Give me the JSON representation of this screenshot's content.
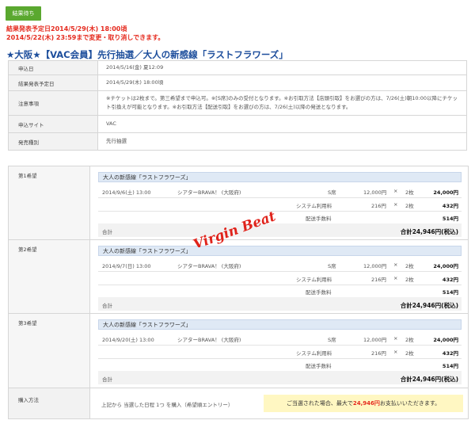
{
  "status_badge": "結果待ち",
  "notice": {
    "line1": "結果発表予定日2014/5/29(木) 18:00頃",
    "line2": "2014/5/22(木) 23:59まで変更・取り消しできます。"
  },
  "title": "★大阪★【VAC会員】先行抽選／大人の新感線「ラストフラワーズ」",
  "info": [
    {
      "label": "申込日",
      "value": "2014/5/16(金) 夏12:09"
    },
    {
      "label": "結果発表予定日",
      "value": "2014/5/29(木) 18:00頃"
    },
    {
      "label": "注意事項",
      "value": "※チケットは2枚まで。第三希望まで申込可。※[S席]のみの受付となります。※お引取方法【店頭引取】をお選びの方は、7/26(土)朝10:00以降にチケット引換えが可能となります。※お引取方法【配送引取】をお選びの方は、7/26(土)以降の発送となります。"
    },
    {
      "label": "申込サイト",
      "value": "VAC"
    },
    {
      "label": "発売種別",
      "value": "先行抽選"
    }
  ],
  "hopes": [
    {
      "label": "第1希望",
      "event": "大人の新感線「ラストフラワーズ」",
      "date": "2014/9/6(土) 13:00",
      "venue": "シアターBRAVA！ (大阪府)",
      "seat": "S席",
      "unit_price": "12,000円",
      "times": "×",
      "qty": "2枚",
      "amount": "24,000円",
      "sys_label": "システム利用料",
      "sys_unit": "216円",
      "sys_qty": "2枚",
      "sys_amount": "432円",
      "ship_label": "配送手数料",
      "ship_amount": "514円",
      "total_label": "合計",
      "total": "合計24,946円(税込)"
    },
    {
      "label": "第2希望",
      "event": "大人の新感線「ラストフラワーズ」",
      "date": "2014/9/7(日) 13:00",
      "venue": "シアターBRAVA！ (大阪府)",
      "seat": "S席",
      "unit_price": "12,000円",
      "times": "×",
      "qty": "2枚",
      "amount": "24,000円",
      "sys_label": "システム利用料",
      "sys_unit": "216円",
      "sys_qty": "2枚",
      "sys_amount": "432円",
      "ship_label": "配送手数料",
      "ship_amount": "514円",
      "total_label": "合計",
      "total": "合計24,946円(税込)"
    },
    {
      "label": "第3希望",
      "event": "大人の新感線「ラストフラワーズ」",
      "date": "2014/9/20(土) 13:00",
      "venue": "シアターBRAVA！ (大阪府)",
      "seat": "S席",
      "unit_price": "12,000円",
      "times": "×",
      "qty": "2枚",
      "amount": "24,000円",
      "sys_label": "システム利用料",
      "sys_unit": "216円",
      "sys_qty": "2枚",
      "sys_amount": "432円",
      "ship_label": "配送手数料",
      "ship_amount": "514円",
      "total_label": "合計",
      "total": "合計24,946円(税込)"
    }
  ],
  "signature": "Virgin Beat",
  "purchase": {
    "label": "購入方法",
    "method": "上記から 当選した日程 1つ を購入（希望順エントリー）",
    "note_prefix": "ご当選された場合、最大で",
    "note_amount": "24,946円",
    "note_suffix": "お支払いいただきます。"
  },
  "colors": {
    "badge": "#5aa82f",
    "notice": "#e52a1e",
    "title": "#1d4e9c",
    "event_header": "#dfe9f5",
    "note_bg": "#fff7c2"
  }
}
